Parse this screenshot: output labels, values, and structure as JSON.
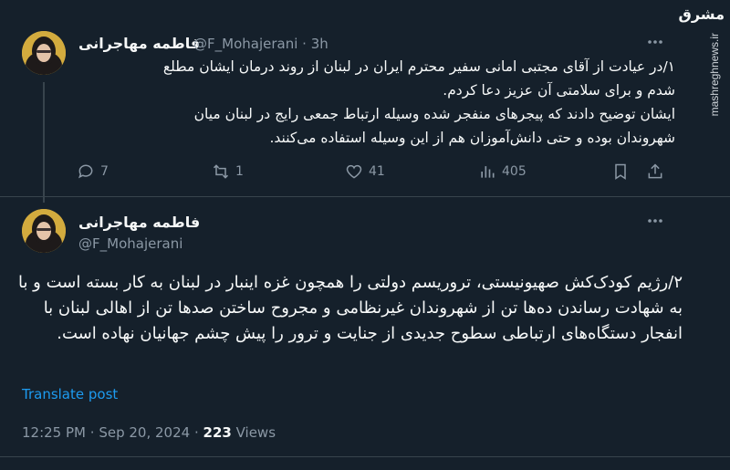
{
  "colors": {
    "background": "#15202b",
    "text": "#f7f9f9",
    "muted": "#8b98a5",
    "link": "#1d9bf0",
    "divider": "#38444d"
  },
  "tweet1": {
    "name": "فاطمه مهاجرانی",
    "handle": "@F_Mohajerani",
    "separator": "·",
    "time": "3h",
    "text_lines": [
      "۱/در عیادت از آقای مجتبی امانی سفیر محترم ایران در لبنان از روند درمان ایشان مطلع شدم و برای سلامتی آن عزیز دعا کردم.",
      "ایشان توضیح دادند که پیجرهای منفجر شده وسیله ارتباط جمعی رایج در لبنان میان شهروندان بوده و حتی دانش‌آموزان هم از این وسیله استفاده می‌کنند."
    ],
    "actions": {
      "replies": "7",
      "reposts": "1",
      "likes": "41",
      "views": "405"
    }
  },
  "tweet2": {
    "name": "فاطمه مهاجرانی",
    "handle": "@F_Mohajerani",
    "text": "۲/رژیم کودک‌کش صهیونیستی، تروریسم دولتی را همچون غزه اینبار در لبنان به کار بسته است و با به شهادت رساندن ده‌ها تن از شهروندان غیرنظامی و مجروح ساختن صدها تن از اهالی لبنان با انفجار دستگاه‌های ارتباطی سطوح جدیدی از جنایت و ترور را پیش چشم جهانیان نهاده است.",
    "translate": "Translate post",
    "time": "12:25 PM",
    "separator": "·",
    "date": "Sep 20, 2024",
    "views_count": "223",
    "views_label": "Views"
  },
  "watermark": {
    "logo": "مشرق",
    "site": "mashreghnews.ir"
  },
  "icons": [
    "more-icon",
    "reply-icon",
    "repost-icon",
    "like-icon",
    "views-icon",
    "bookmark-icon",
    "share-icon"
  ]
}
